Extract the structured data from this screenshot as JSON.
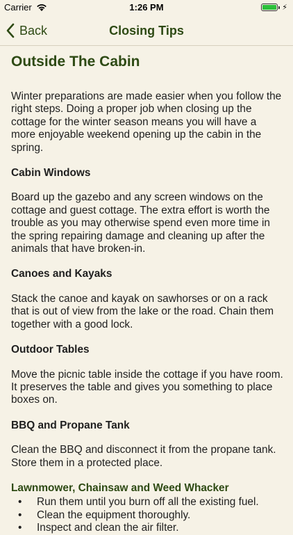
{
  "status_bar": {
    "carrier": "Carrier",
    "time": "1:26 PM",
    "battery_level": 1.0,
    "battery_color": "#2bbf3a",
    "icons": [
      "wifi-icon",
      "battery-icon",
      "charging-icon"
    ]
  },
  "nav": {
    "back_label": "Back",
    "title": "Closing Tips",
    "accent_color": "#2e4a14"
  },
  "article": {
    "title": "Outside The Cabin",
    "intro": "Winter preparations are made easier when you follow the right steps. Doing a proper job when closing up the cottage for the winter season means you will have a more enjoyable weekend opening up the cabin in the spring.",
    "sections": [
      {
        "heading": "Cabin Windows",
        "body": "Board up the gazebo and any screen windows on the cottage and guest cottage.  The extra effort is worth the trouble as you may otherwise spend even more time in the spring repairing damage and cleaning up after the animals that have broken-in."
      },
      {
        "heading": "Canoes and Kayaks",
        "body": "Stack the canoe and kayak on sawhorses or on a rack that is out of view from the lake or the road.  Chain them together with a good lock."
      },
      {
        "heading": "Outdoor Tables",
        "body": "Move the picnic table inside the cottage if you have room.  It preserves the table and gives you something to place boxes on."
      },
      {
        "heading": "BBQ and Propane Tank",
        "body": "Clean the BBQ and disconnect it from the propane tank. Store them in a protected place."
      }
    ],
    "lawn_section": {
      "heading": "Lawnmower, Chainsaw and Weed Whacker",
      "bullets": [
        "Run them until you burn off all the existing fuel.",
        "Clean the equipment thoroughly.",
        "Inspect and clean the air filter."
      ]
    }
  }
}
